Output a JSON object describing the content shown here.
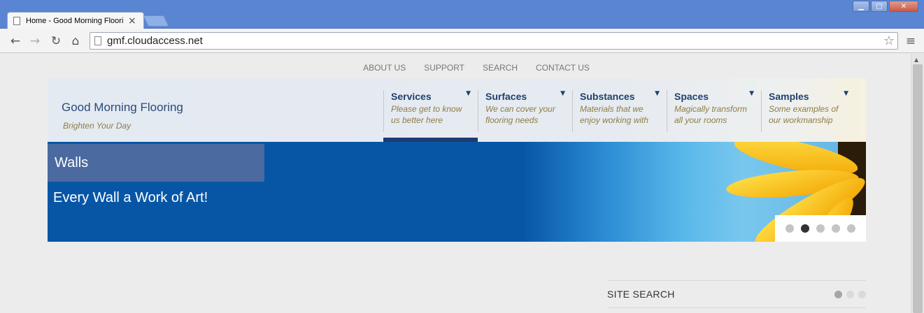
{
  "browser": {
    "tab_title": "Home - Good Morning Flooring",
    "tab_close": "×",
    "url": "gmf.cloudaccess.net",
    "window_buttons": {
      "minimize": "▁",
      "maximize": "▢",
      "close": "✕"
    },
    "icons": {
      "back": "back-arrow-icon",
      "forward": "forward-arrow-icon",
      "reload": "reload-icon",
      "home": "home-icon",
      "star": "star-icon",
      "menu": "menu-icon"
    }
  },
  "topnav": [
    "ABOUT US",
    "SUPPORT",
    "SEARCH",
    "CONTACT US"
  ],
  "site": {
    "name": "Good Morning Flooring",
    "tagline": "Brighten Your Day"
  },
  "mainnav": [
    {
      "name": "Services",
      "desc": "Please get to know us better here"
    },
    {
      "name": "Surfaces",
      "desc": "We can cover your flooring needs"
    },
    {
      "name": "Substances",
      "desc": "Materials that we enjoy working with"
    },
    {
      "name": "Spaces",
      "desc": "Magically transform all your rooms"
    },
    {
      "name": "Samples",
      "desc": "Some examples of our workmanship"
    }
  ],
  "banner": {
    "tag": "Walls",
    "caption": "Every Wall a Work of Art!",
    "slide_count": 5,
    "active_slide": 2
  },
  "sidebar": {
    "site_search_label": "SITE SEARCH",
    "pager_count": 3,
    "pager_active": 1
  },
  "colors": {
    "banner_blue": "#0756a6",
    "nav_text": "#21416d",
    "tagline": "#8d7c45",
    "active_bar": "#1f3a72"
  }
}
